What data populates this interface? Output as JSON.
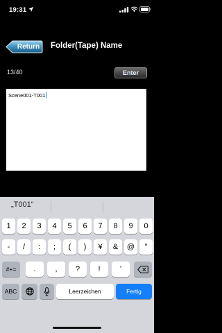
{
  "status": {
    "time": "19:31",
    "location_icon": "location-arrow-icon",
    "signal_icon": "cellular-signal-icon",
    "wifi_icon": "wifi-icon",
    "battery_icon": "battery-icon"
  },
  "nav": {
    "return_label": "Return",
    "title": "Folder(Tape) Name"
  },
  "counter": "13/40",
  "enter_label": "Enter",
  "text_field": {
    "value": "Scene001-T001"
  },
  "keyboard": {
    "suggestion": "„T001“",
    "row1": [
      "1",
      "2",
      "3",
      "4",
      "5",
      "6",
      "7",
      "8",
      "9",
      "0"
    ],
    "row2": [
      "-",
      "/",
      ":",
      ";",
      "(",
      ")",
      "¥",
      "&",
      "@",
      "”"
    ],
    "row3": {
      "shift_label": "#+=",
      "keys": [
        ".",
        ",",
        "?",
        "!",
        "’"
      ],
      "backspace_icon": "backspace-icon"
    },
    "row4": {
      "abc_label": "ABC",
      "globe_icon": "globe-icon",
      "mic_icon": "microphone-icon",
      "space_label": "Leerzeichen",
      "done_label": "Fertig"
    }
  },
  "colors": {
    "background": "#000000",
    "keyboard_bg": "#d4d6dc",
    "done_key": "#147efb",
    "caret": "#2f7cf6"
  }
}
